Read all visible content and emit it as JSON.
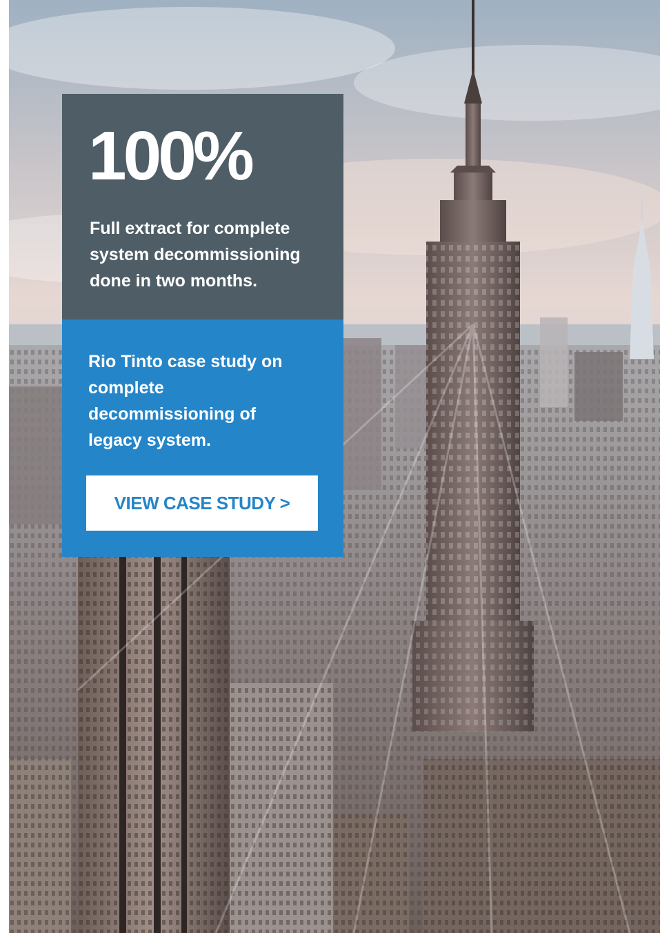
{
  "stat": {
    "figure": "100%",
    "description": "Full extract for complete system decommissioning done in two months."
  },
  "case_study": {
    "description": "Rio Tinto case study on complete decommissioning of legacy system.",
    "button_label": "VIEW CASE STUDY >"
  },
  "colors": {
    "stat_card_bg": "#4f5e66",
    "case_card_bg": "#2585c9",
    "button_text": "#2585c9"
  }
}
